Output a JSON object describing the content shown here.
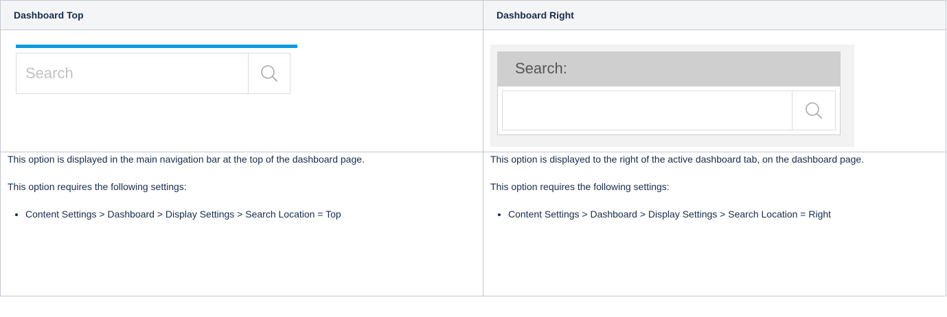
{
  "table": {
    "headers": [
      "Dashboard Top",
      "Dashboard Right"
    ],
    "left": {
      "mock": {
        "search_placeholder": "Search",
        "accent_color": "#0a9ae0",
        "search_button_icon": "search-icon"
      },
      "description": "This option is displayed in the main navigation bar at the top of the dashboard page.",
      "requirements_intro": "This option requires the following settings:",
      "requirements": [
        "Content Settings > Dashboard > Display Settings > Search Location = Top"
      ]
    },
    "right": {
      "mock": {
        "search_label": "Search:",
        "search_button_icon": "search-icon"
      },
      "description": "This option is displayed to the right of the active dashboard tab, on the dashboard page.",
      "requirements_intro": "This option requires the following settings:",
      "requirements": [
        "Content Settings > Dashboard > Display Settings > Search Location = Right"
      ]
    }
  }
}
